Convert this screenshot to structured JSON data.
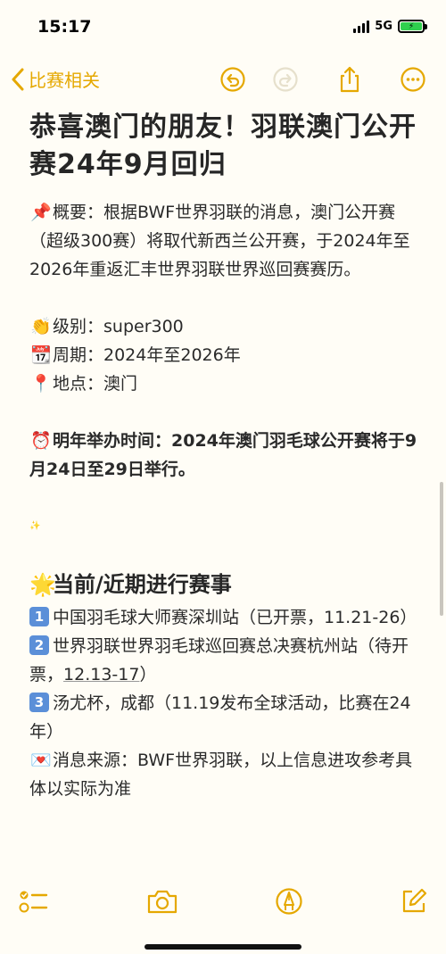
{
  "status": {
    "time": "15:17",
    "network": "5G"
  },
  "nav": {
    "back_label": "比赛相关"
  },
  "note": {
    "title": "恭喜澳门的朋友！羽联澳门公开赛24年9月回归",
    "overview": "概要：根据BWF世界羽联的消息，澳门公开赛（超级300赛）将取代新西兰公开赛，于2024年至2026年重返汇丰世界羽联世界巡回赛赛历。",
    "level": "级别：super300",
    "period": "周期：2024年至2026年",
    "location": "地点：澳门",
    "next_time": "明年举办时间：2024年澳门羽毛球公开赛将于9月24日至29日举行。",
    "section_title": "当前/近期进行赛事",
    "events": [
      {
        "num": "1",
        "text": "中国羽毛球大师赛深圳站（已开票，11.21-26）"
      },
      {
        "num": "2",
        "text_a": "世界羽联世界羽毛球巡回赛总决赛杭州站（待开票，",
        "text_b": "12.13-17",
        "text_c": "）"
      },
      {
        "num": "3",
        "text": "汤尤杯，成都（11.19发布全球活动，比赛在24年）"
      }
    ],
    "source": "消息来源：BWF世界羽联，以上信息进攻参考具体以实际为准"
  },
  "icons": {
    "pin": "pushpin-icon",
    "clap": "clapping-hands-icon",
    "calendar": "calendar-icon",
    "location": "round-pin-icon",
    "alarm": "alarm-clock-icon",
    "star": "glowing-star-icon",
    "letter": "love-letter-icon"
  },
  "colors": {
    "accent": "#e5a800",
    "background": "#fffdf6",
    "badge": "#5b8fd8"
  }
}
